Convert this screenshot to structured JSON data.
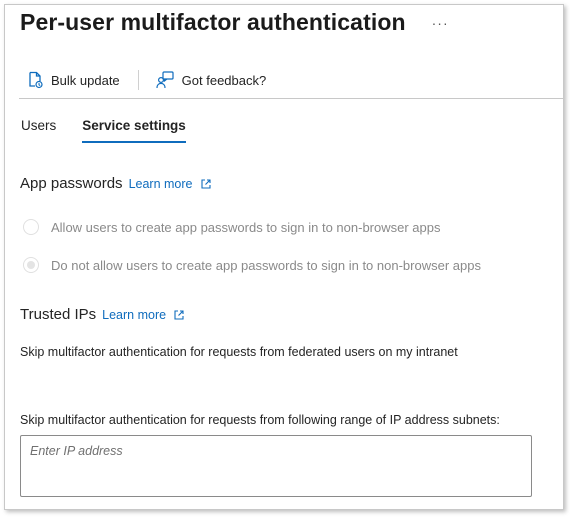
{
  "header": {
    "title": "Per-user multifactor authentication",
    "more_label": "···"
  },
  "toolbar": {
    "bulk_update_label": "Bulk update",
    "feedback_label": "Got feedback?"
  },
  "tabs": [
    {
      "label": "Users",
      "active": false
    },
    {
      "label": "Service settings",
      "active": true
    }
  ],
  "app_passwords": {
    "title": "App passwords",
    "learn_more": "Learn more",
    "options": [
      {
        "label": "Allow users to create app passwords to sign in to non-browser apps",
        "checked": false
      },
      {
        "label": "Do not allow users to create app passwords to sign in to non-browser apps",
        "checked": true
      }
    ]
  },
  "trusted_ips": {
    "title": "Trusted IPs",
    "learn_more": "Learn more",
    "federated_text": "Skip multifactor authentication for requests from federated users on my intranet",
    "subnets_label": "Skip multifactor authentication for requests from following range of IP address subnets:",
    "ip_placeholder": "Enter IP address"
  },
  "colors": {
    "accent": "#0f6cbd",
    "disabled_text": "#8a8a8a"
  }
}
